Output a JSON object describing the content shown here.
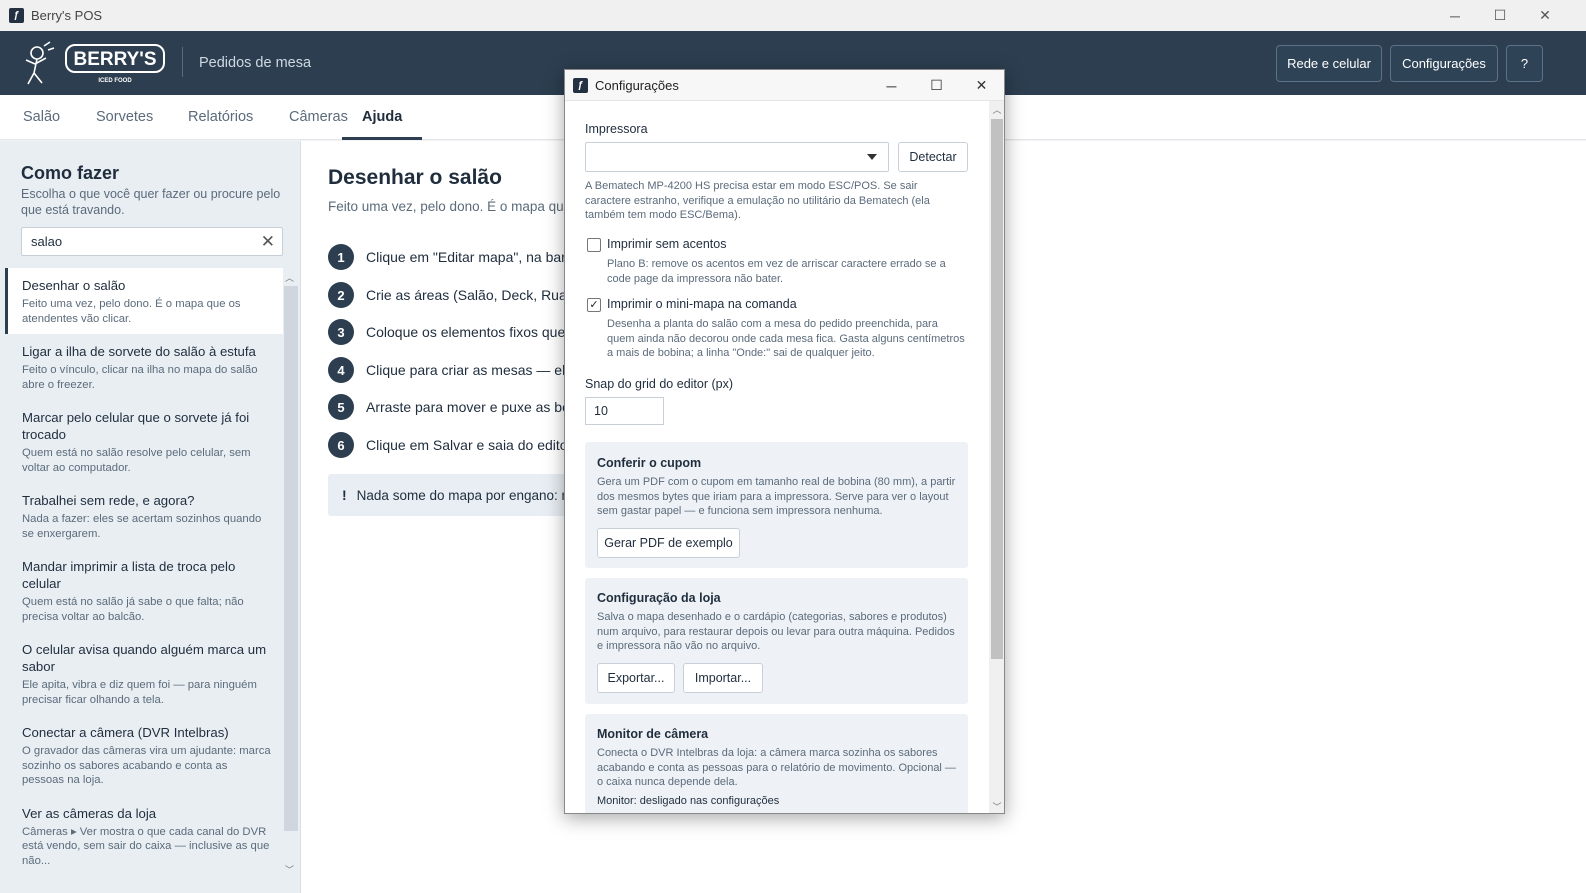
{
  "window": {
    "title": "Berry's POS",
    "minimize": "─",
    "maximize": "☐",
    "close": "✕"
  },
  "header": {
    "logo_text": "BERRY'S",
    "logo_sub": "ICED FOOD",
    "subtitle": "Pedidos de mesa",
    "buttons": {
      "network": "Rede e celular",
      "settings": "Configurações",
      "help": "?"
    }
  },
  "tabs": [
    {
      "label": "Salão"
    },
    {
      "label": "Sorvetes"
    },
    {
      "label": "Relatórios"
    },
    {
      "label": "Câmeras"
    },
    {
      "label": "Ajuda",
      "active": true
    }
  ],
  "sidebar": {
    "title": "Como fazer",
    "intro": "Escolha o que você quer fazer ou procure pelo que está travando.",
    "search_value": "salao",
    "clear_icon": "✕",
    "items": [
      {
        "title": "Desenhar o salão",
        "desc": "Feito uma vez, pelo dono. É o mapa que os atendentes vão clicar.",
        "active": true
      },
      {
        "title": "Ligar a ilha de sorvete do salão à estufa",
        "desc": "Feito o vínculo, clicar na ilha no mapa do salão abre o freezer."
      },
      {
        "title": "Marcar pelo celular que o sorvete já foi trocado",
        "desc": "Quem está no salão resolve pelo celular, sem voltar ao computador."
      },
      {
        "title": "Trabalhei sem rede, e agora?",
        "desc": "Nada a fazer: eles se acertam sozinhos quando se enxergarem."
      },
      {
        "title": "Mandar imprimir a lista de troca pelo celular",
        "desc": "Quem está no salão já sabe o que falta; não precisa voltar ao balcão."
      },
      {
        "title": "O celular avisa quando alguém marca um sabor",
        "desc": "Ele apita, vibra e diz quem foi — para ninguém precisar ficar olhando a tela."
      },
      {
        "title": "Conectar a câmera (DVR Intelbras)",
        "desc": "O gravador das câmeras vira um ajudante: marca sozinho os sabores acabando e conta as pessoas na loja."
      },
      {
        "title": "Ver as câmeras da loja",
        "desc": "Câmeras ▸ Ver mostra o que cada canal do DVR está vendo, sem sair do caixa — inclusive as que não..."
      }
    ]
  },
  "content": {
    "title": "Desenhar o salão",
    "lead": "Feito uma vez, pelo dono. É o mapa que",
    "steps": [
      {
        "n": "1",
        "text": "Clique em \"Editar mapa\", na bar"
      },
      {
        "n": "2",
        "text": "Crie as áreas (Salão, Deck, Rua)"
      },
      {
        "n": "3",
        "text": "Coloque os elementos fixos que"
      },
      {
        "n": "4",
        "text": "Clique para criar as mesas — ela"
      },
      {
        "n": "5",
        "text": "Arraste para mover e puxe as bo"
      },
      {
        "n": "6",
        "text": "Clique em Salvar e saia do edito"
      }
    ],
    "warning_mark": "!",
    "warning": "Nada some do mapa por engano: m"
  },
  "dialog": {
    "title": "Configurações",
    "printer_label": "Impressora",
    "printer_value": "",
    "detect_button": "Detectar",
    "printer_help": "A Bematech MP-4200 HS precisa estar em modo ESC/POS. Se sair caractere estranho, verifique a emulação no utilitário da Bematech (ela também tem modo ESC/Bema).",
    "no_accents": {
      "label": "Imprimir sem acentos",
      "checked": false,
      "help": "Plano B: remove os acentos em vez de arriscar caractere errado se a code page da impressora não bater."
    },
    "minimap": {
      "label": "Imprimir o mini-mapa na comanda",
      "checked": true,
      "help": "Desenha a planta do salão com a mesa do pedido preenchida, para quem ainda não decorou onde cada mesa fica. Gasta alguns centímetros a mais de bobina; a linha \"Onde:\" sai de qualquer jeito."
    },
    "snap_label": "Snap do grid do editor (px)",
    "snap_value": "10",
    "coupon": {
      "title": "Conferir o cupom",
      "desc": "Gera um PDF com o cupom em tamanho real de bobina (80 mm), a partir dos mesmos bytes que iriam para a impressora. Serve para ver o layout sem gastar papel — e funciona sem impressora nenhuma.",
      "button": "Gerar PDF de exemplo"
    },
    "store": {
      "title": "Configuração da loja",
      "desc": "Salva o mapa desenhado e o cardápio (categorias, sabores e produtos) num arquivo, para restaurar depois ou levar para outra máquina. Pedidos e impressora não vão no arquivo.",
      "export": "Exportar...",
      "import": "Importar..."
    },
    "camera": {
      "title": "Monitor de câmera",
      "desc": "Conecta o DVR Intelbras da loja: a câmera marca sozinha os sabores acabando e conta as pessoas para o relatório de movimento. Opcional — o caixa nunca depende dela.",
      "status": "Monitor: desligado nas configurações"
    }
  }
}
